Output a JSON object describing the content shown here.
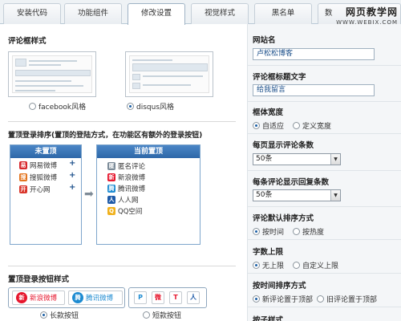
{
  "tabs": [
    {
      "label": "安装代码"
    },
    {
      "label": "功能组件"
    },
    {
      "label": "修改设置",
      "active": true
    },
    {
      "label": "视觉样式"
    },
    {
      "label": "黑名单"
    },
    {
      "label": "数"
    }
  ],
  "watermark": {
    "line1": "网页教学网",
    "line2": "WWW.WEBJX.COM"
  },
  "left": {
    "style_title": "评论框样式",
    "style_options": [
      {
        "label": "facebook风格",
        "selected": false
      },
      {
        "label": "disqus风格",
        "selected": true
      }
    ],
    "login_sort_title": "置顶登录排序(置顶的登陆方式，在功能区有额外的登录按钮)",
    "not_pinned": {
      "header": "未置顶",
      "items": [
        {
          "label": "网易微博",
          "icon": "netease-icon",
          "color": "#d7262b",
          "glyph": "易"
        },
        {
          "label": "搜狐微博",
          "icon": "sohu-icon",
          "color": "#e3731b",
          "glyph": "搜"
        },
        {
          "label": "开心网",
          "icon": "kaixin-icon",
          "color": "#d9352a",
          "glyph": "开"
        }
      ]
    },
    "pinned": {
      "header": "当前置顶",
      "items": [
        {
          "label": "匿名评论",
          "icon": "anonymous-icon",
          "color": "#7c8b98",
          "glyph": "匿"
        },
        {
          "label": "新浪微博",
          "icon": "sina-weibo-icon",
          "color": "#e6162d",
          "glyph": "新"
        },
        {
          "label": "腾讯微博",
          "icon": "tencent-weibo-icon",
          "color": "#1d8bd1",
          "glyph": "腾"
        },
        {
          "label": "人人网",
          "icon": "renren-icon",
          "color": "#1e5aa8",
          "glyph": "人"
        },
        {
          "label": "QQ空间",
          "icon": "qzone-icon",
          "color": "#f0b11d",
          "glyph": "Q"
        }
      ]
    },
    "button_style_title": "置顶登录按钮样式",
    "button_options": [
      {
        "label": "长款按钮",
        "selected": true
      },
      {
        "label": "短款按钮",
        "selected": false
      }
    ],
    "long_buttons": [
      {
        "label": "新浪微博",
        "icon": "sina-weibo-icon",
        "color": "#e6162d"
      },
      {
        "label": "腾讯微博",
        "icon": "tencent-weibo-icon",
        "color": "#1d8bd1"
      }
    ],
    "short_button_glyphs": [
      "P",
      "微",
      "T",
      "人"
    ]
  },
  "right": {
    "site_name_label": "网站名",
    "site_name_value": "卢松松博客",
    "box_title_label": "评论框标题文字",
    "box_title_value": "给我留言",
    "width_label": "框体宽度",
    "width_options": [
      {
        "label": "自适应",
        "selected": true
      },
      {
        "label": "定义宽度",
        "selected": false
      }
    ],
    "per_page_label": "每页显示评论条数",
    "per_page_value": "50条",
    "reply_count_label": "每条评论显示回复条数",
    "reply_count_value": "50条",
    "sort_label": "评论默认排序方式",
    "sort_options": [
      {
        "label": "按时间",
        "selected": true
      },
      {
        "label": "按热度",
        "selected": false
      }
    ],
    "word_limit_label": "字数上限",
    "word_limit_options": [
      {
        "label": "无上限",
        "selected": true
      },
      {
        "label": "自定义上限",
        "selected": false
      }
    ],
    "time_sort_label": "按时间排序方式",
    "time_sort_options": [
      {
        "label": "新评论置于顶部",
        "selected": true
      },
      {
        "label": "旧评论置于顶部",
        "selected": false
      }
    ],
    "cut_label": "按子样式"
  }
}
